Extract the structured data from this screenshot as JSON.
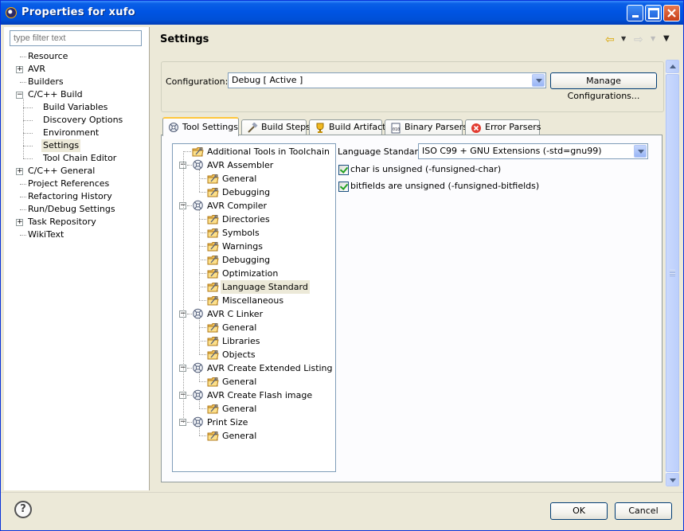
{
  "window": {
    "title": "Properties for xufo"
  },
  "filter": {
    "placeholder": "type filter text"
  },
  "nav": {
    "items": [
      {
        "label": "Resource",
        "depth": 0,
        "expander": ""
      },
      {
        "label": "AVR",
        "depth": 0,
        "expander": "+"
      },
      {
        "label": "Builders",
        "depth": 0,
        "expander": ""
      },
      {
        "label": "C/C++ Build",
        "depth": 0,
        "expander": "-"
      },
      {
        "label": "Build Variables",
        "depth": 1,
        "expander": ""
      },
      {
        "label": "Discovery Options",
        "depth": 1,
        "expander": ""
      },
      {
        "label": "Environment",
        "depth": 1,
        "expander": ""
      },
      {
        "label": "Settings",
        "depth": 1,
        "expander": "",
        "selected": true
      },
      {
        "label": "Tool Chain Editor",
        "depth": 1,
        "expander": ""
      },
      {
        "label": "C/C++ General",
        "depth": 0,
        "expander": "+"
      },
      {
        "label": "Project References",
        "depth": 0,
        "expander": ""
      },
      {
        "label": "Refactoring History",
        "depth": 0,
        "expander": ""
      },
      {
        "label": "Run/Debug Settings",
        "depth": 0,
        "expander": ""
      },
      {
        "label": "Task Repository",
        "depth": 0,
        "expander": "+"
      },
      {
        "label": "WikiText",
        "depth": 0,
        "expander": ""
      }
    ]
  },
  "header": {
    "title": "Settings"
  },
  "config": {
    "label": "Configuration:",
    "value": "Debug  [ Active ]",
    "manage_label": "Manage Configurations..."
  },
  "tabs": [
    {
      "label": "Tool Settings",
      "icon": "tool-settings-icon"
    },
    {
      "label": "Build Steps",
      "icon": "build-steps-icon"
    },
    {
      "label": "Build Artifact",
      "icon": "build-artifact-icon"
    },
    {
      "label": "Binary Parsers",
      "icon": "binary-parsers-icon"
    },
    {
      "label": "Error Parsers",
      "icon": "error-parsers-icon"
    }
  ],
  "tooltree": {
    "nodes": [
      {
        "label": "Additional Tools in Toolchain",
        "kind": "option",
        "depth": 0
      },
      {
        "label": "AVR Assembler",
        "kind": "tool",
        "depth": 0
      },
      {
        "label": "General",
        "kind": "option",
        "depth": 1
      },
      {
        "label": "Debugging",
        "kind": "option",
        "depth": 1
      },
      {
        "label": "AVR Compiler",
        "kind": "tool",
        "depth": 0
      },
      {
        "label": "Directories",
        "kind": "option",
        "depth": 1
      },
      {
        "label": "Symbols",
        "kind": "option",
        "depth": 1
      },
      {
        "label": "Warnings",
        "kind": "option",
        "depth": 1
      },
      {
        "label": "Debugging",
        "kind": "option",
        "depth": 1
      },
      {
        "label": "Optimization",
        "kind": "option",
        "depth": 1
      },
      {
        "label": "Language Standard",
        "kind": "option",
        "depth": 1,
        "selected": true
      },
      {
        "label": "Miscellaneous",
        "kind": "option",
        "depth": 1
      },
      {
        "label": "AVR C Linker",
        "kind": "tool",
        "depth": 0
      },
      {
        "label": "General",
        "kind": "option",
        "depth": 1
      },
      {
        "label": "Libraries",
        "kind": "option",
        "depth": 1
      },
      {
        "label": "Objects",
        "kind": "option",
        "depth": 1
      },
      {
        "label": "AVR Create Extended Listing",
        "kind": "tool",
        "depth": 0
      },
      {
        "label": "General",
        "kind": "option",
        "depth": 1
      },
      {
        "label": "AVR Create Flash image",
        "kind": "tool",
        "depth": 0
      },
      {
        "label": "General",
        "kind": "option",
        "depth": 1
      },
      {
        "label": "Print Size",
        "kind": "tool",
        "depth": 0
      },
      {
        "label": "General",
        "kind": "option",
        "depth": 1
      }
    ]
  },
  "language": {
    "label": "Language Standard",
    "value": "ISO C99 + GNU Extensions (-std=gnu99)",
    "checks": [
      {
        "label": "char is unsigned (-funsigned-char)",
        "checked": true
      },
      {
        "label": "bitfields are unsigned (-funsigned-bitfields)",
        "checked": true
      }
    ]
  },
  "buttons": {
    "help": "?",
    "ok": "OK",
    "cancel": "Cancel"
  },
  "colors": {
    "titlebar": "#0054e3",
    "window_bg": "#ece9d8",
    "tab_accent": "#ffc73c",
    "check": "#21a121"
  }
}
